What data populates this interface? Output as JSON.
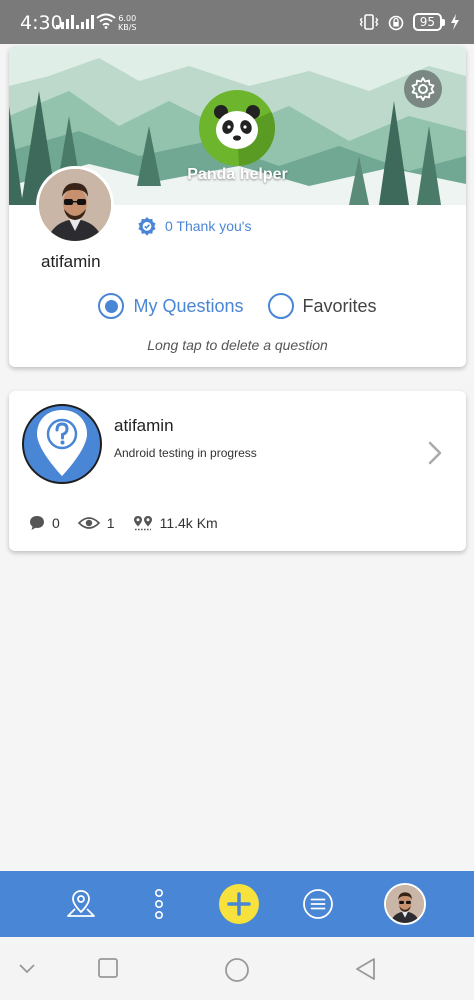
{
  "status_bar": {
    "time": "4:30",
    "net_speed_value": "6.00",
    "net_speed_unit": "KB/S",
    "battery": "95",
    "icons": [
      "signal-icon",
      "signal-icon",
      "wifi-icon",
      "vibrate-icon",
      "alarm-icon",
      "battery-icon",
      "charging-icon"
    ]
  },
  "profile": {
    "badge_name": "Panda helper",
    "thanks": "0 Thank you's",
    "username": "atifamin",
    "tabs": [
      {
        "label": "My Questions",
        "selected": true
      },
      {
        "label": "Favorites",
        "selected": false
      }
    ],
    "hint": "Long tap to delete a question"
  },
  "questions": [
    {
      "user": "atifamin",
      "text": "Android testing in progress",
      "comments": "0",
      "views": "1",
      "distance": "11.4k Km"
    }
  ],
  "bottom_nav": {
    "items": [
      "location-pin-icon",
      "more-vertical-icon",
      "add-icon",
      "list-icon",
      "profile-avatar"
    ]
  },
  "colors": {
    "accent": "#4a86d6",
    "add_button": "#f7e23d",
    "panda_badge": "#6cb52d",
    "status_bar": "#7a7a7a"
  }
}
